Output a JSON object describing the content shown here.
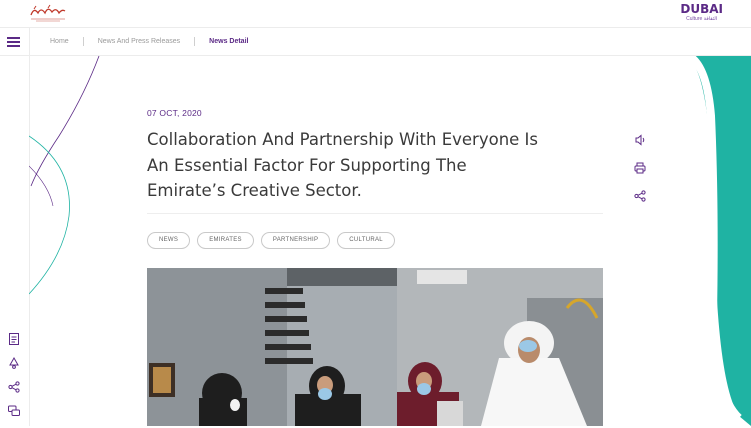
{
  "header": {
    "gov_logo": "government-of-dubai-logo",
    "brand_name": "DUBAI",
    "brand_sub": "Culture الثقافة"
  },
  "breadcrumb": {
    "items": [
      "Home",
      "News And Press Releases",
      "News Detail"
    ]
  },
  "article": {
    "date": "07 OCT, 2020",
    "title": "Collaboration And Partnership With Everyone Is An Essential Factor For Supporting The Emirate’s Creative Sector.",
    "tags": [
      "NEWS",
      "EMIRATES",
      "PARTNERSHIP",
      "CULTURAL"
    ]
  },
  "actions": [
    "speaker-icon",
    "print-icon",
    "share-icon"
  ],
  "sidebar_icons": [
    "document-icon",
    "recycle-icon",
    "share-icon",
    "chat-icon"
  ],
  "colors": {
    "brand_purple": "#5b2a86",
    "teal_accent": "#1fb3a3"
  }
}
